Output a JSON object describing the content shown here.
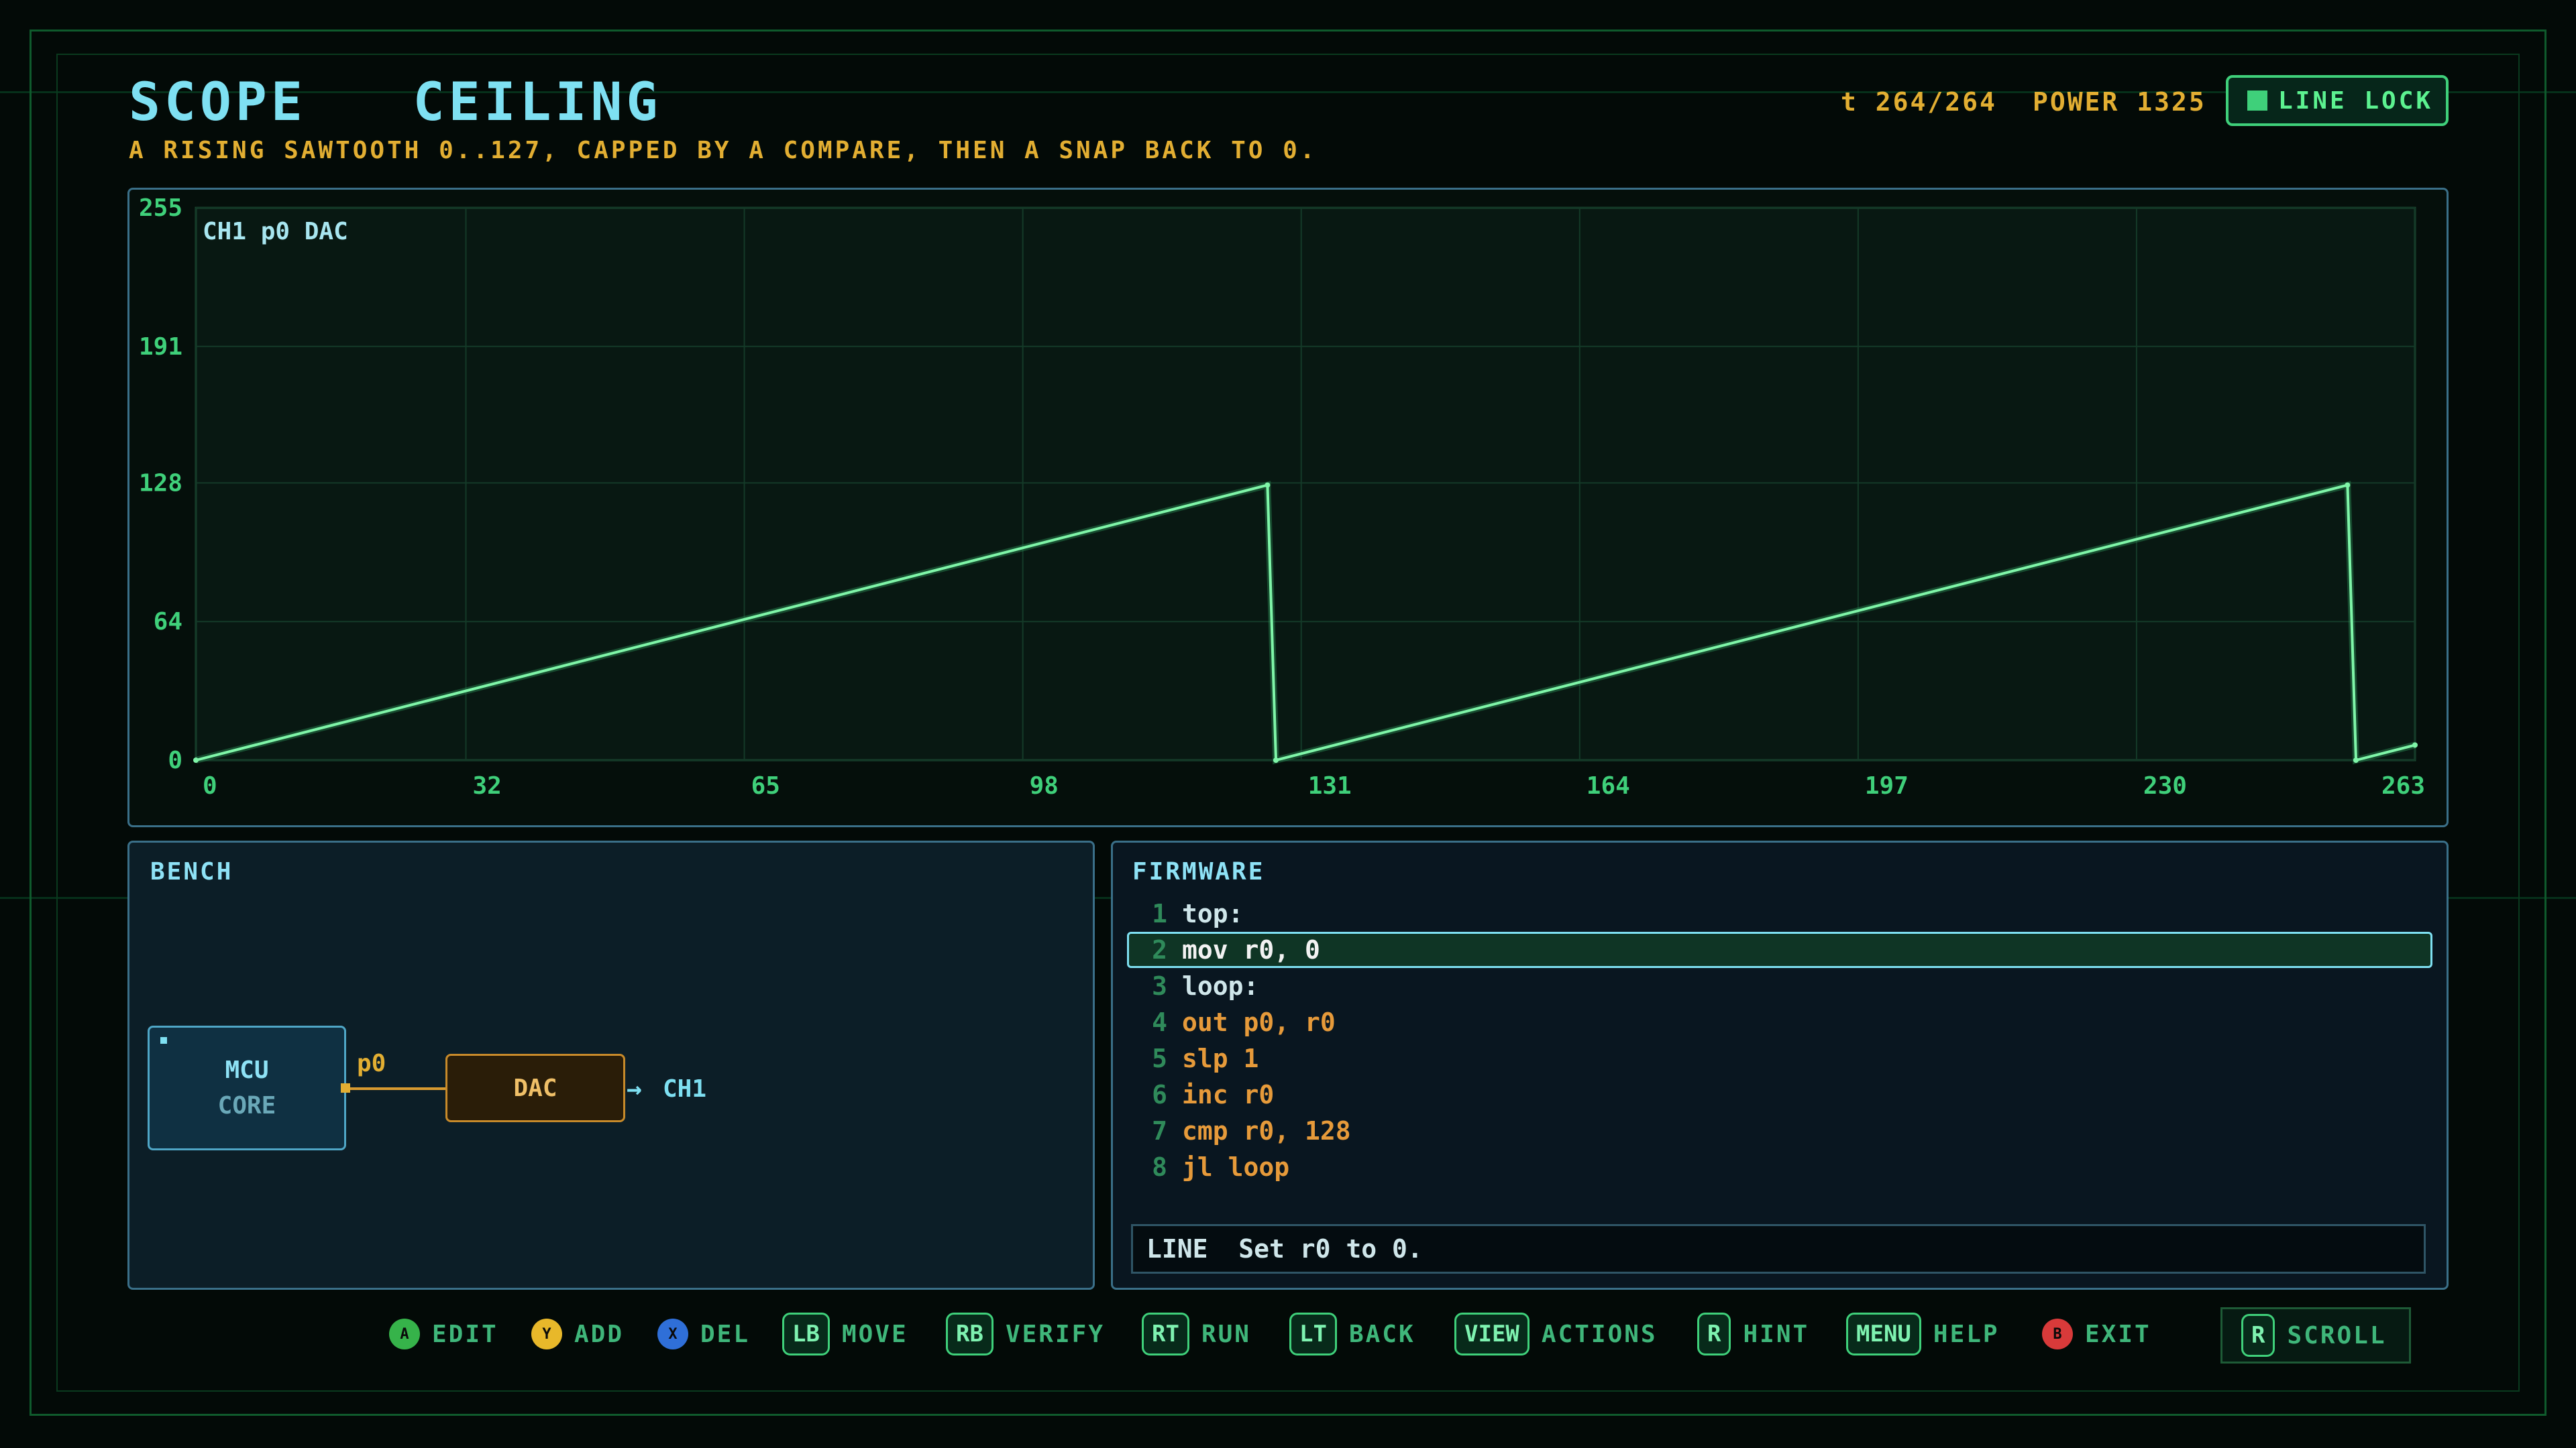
{
  "header": {
    "title": "SCOPE   CEILING",
    "subtitle": "A RISING SAWTOOTH 0..127, CAPPED BY A COMPARE, THEN A SNAP BACK TO 0.",
    "tick": "t 264/264",
    "power": "POWER 1325",
    "line_lock": "LINE LOCK"
  },
  "scope": {
    "channel_label": "CH1 p0 DAC"
  },
  "chart_data": {
    "type": "line",
    "x_ticks": [
      "0",
      "32",
      "65",
      "98",
      "131",
      "164",
      "197",
      "230",
      "263"
    ],
    "y_ticks": [
      "0",
      "64",
      "128",
      "191",
      "255"
    ],
    "xlim": [
      0,
      263
    ],
    "ylim": [
      0,
      255
    ],
    "grid": true,
    "series": [
      {
        "points": [
          [
            0,
            0
          ],
          [
            127,
            127
          ],
          [
            128,
            0
          ],
          [
            255,
            127
          ],
          [
            256,
            0
          ],
          [
            263,
            7
          ]
        ],
        "color": "#7ff5a8"
      }
    ]
  },
  "bench": {
    "label": "BENCH",
    "mcu_line1": "MCU",
    "mcu_line2": "CORE",
    "pin": "p0",
    "dac": "DAC",
    "out": "CH1"
  },
  "firmware": {
    "label": "FIRMWARE",
    "lines": [
      {
        "n": "1",
        "text": "top:"
      },
      {
        "n": "2",
        "text": "mov r0, 0"
      },
      {
        "n": "3",
        "text": "loop:"
      },
      {
        "n": "4",
        "text": "out p0, r0"
      },
      {
        "n": "5",
        "text": "slp 1"
      },
      {
        "n": "6",
        "text": "inc r0"
      },
      {
        "n": "7",
        "text": "cmp r0, 128"
      },
      {
        "n": "8",
        "text": "jl loop"
      }
    ],
    "selected_line": 2,
    "line_info": "LINE  Set r0 to 0."
  },
  "legend": {
    "a": {
      "key": "A",
      "label": "EDIT"
    },
    "y": {
      "key": "Y",
      "label": "ADD"
    },
    "x": {
      "key": "X",
      "label": "DEL"
    },
    "lb": {
      "key": "LB",
      "label": "MOVE"
    },
    "rb": {
      "key": "RB",
      "label": "VERIFY"
    },
    "rt": {
      "key": "RT",
      "label": "RUN"
    },
    "lt": {
      "key": "LT",
      "label": "BACK"
    },
    "view": {
      "key": "VIEW",
      "label": "ACTIONS"
    },
    "r": {
      "key": "R",
      "label": "HINT"
    },
    "menu": {
      "key": "MENU",
      "label": "HELP"
    },
    "b": {
      "key": "B",
      "label": "EXIT"
    },
    "scroll": {
      "key": "R",
      "label": "SCROLL"
    }
  },
  "colors": {
    "accent_green": "#3fd07a",
    "accent_cyan": "#7ee0f2",
    "accent_amber": "#e2ae32",
    "button_a": "#36b34a",
    "button_y": "#e8b82a",
    "button_x": "#2f6fd8",
    "button_b": "#d83a3a"
  }
}
